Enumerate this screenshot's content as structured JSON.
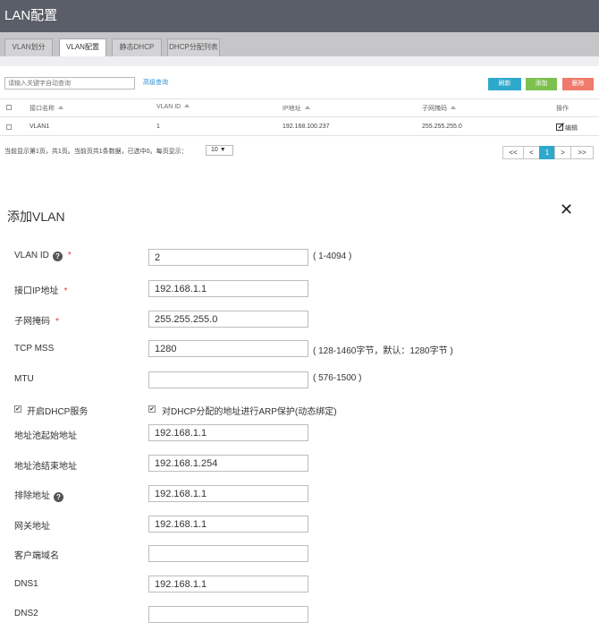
{
  "header": {
    "title": "LAN配置"
  },
  "tabs": [
    {
      "label": "VLAN划分",
      "active": false
    },
    {
      "label": "VLAN配置",
      "active": true
    },
    {
      "label": "静态DHCP",
      "active": false
    },
    {
      "label": "DHCP分配列表",
      "active": false
    }
  ],
  "toolbar": {
    "search_placeholder": "请输入关键字自动查询",
    "advanced_link": "高级查询",
    "refresh_label": "刷新",
    "add_label": "添加",
    "delete_label": "删除",
    "colors": {
      "refresh": "#2ea9cc",
      "add": "#7cc04e",
      "delete": "#f07a6b"
    }
  },
  "table": {
    "columns": [
      "接口名称",
      "VLAN ID",
      "IP地址",
      "子网掩码",
      "操作"
    ],
    "rows": [
      {
        "name": "VLAN1",
        "vlan_id": "1",
        "ip": "192.168.100.237",
        "mask": "255.255.255.0",
        "action_icon": "edit-icon",
        "action_label": "编辑"
      }
    ]
  },
  "pagination": {
    "info": "当前显示第1页，共1页。当前页共1条数据，已选中0。每页显示：",
    "page_size": "10 ▼",
    "first": "<<",
    "prev": "<",
    "current": "1",
    "next": ">",
    "last": ">>"
  },
  "form": {
    "title": "添加VLAN",
    "close_icon": "close-icon",
    "vlan_id": {
      "label": "VLAN ID",
      "value": "2",
      "hint": "( 1-4094 )"
    },
    "interface_ip": {
      "label": "接口IP地址",
      "value": "192.168.1.1"
    },
    "subnet_mask": {
      "label": "子网掩码",
      "value": "255.255.255.0"
    },
    "tcp_mss": {
      "label": "TCP MSS",
      "value": "1280",
      "hint": "( 128-1460字节，默认：1280字节 )"
    },
    "mtu": {
      "label": "MTU",
      "value": "",
      "hint": "( 576-1500 )"
    },
    "enable_dhcp": {
      "label": "开启DHCP服务",
      "checked": true
    },
    "arp_protect": {
      "label": "对DHCP分配的地址进行ARP保护(动态绑定)",
      "checked": true
    },
    "pool_start": {
      "label": "地址池起始地址",
      "value": "192.168.1.1"
    },
    "pool_end": {
      "label": "地址池结束地址",
      "value": "192.168.1.254"
    },
    "exclude": {
      "label": "排除地址",
      "value": "192.168.1.1"
    },
    "gateway": {
      "label": "网关地址",
      "value": "192.168.1.1"
    },
    "domain": {
      "label": "客户端域名",
      "value": ""
    },
    "dns1": {
      "label": "DNS1",
      "value": "192.168.1.1"
    },
    "dns2": {
      "label": "DNS2",
      "value": ""
    }
  }
}
